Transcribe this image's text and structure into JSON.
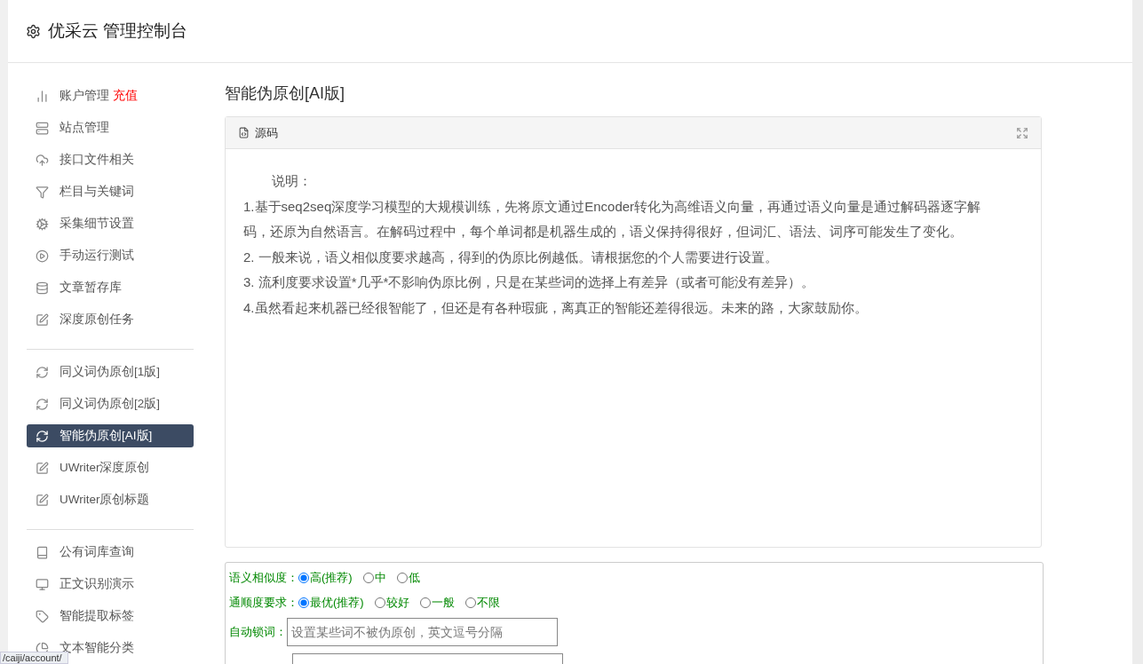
{
  "header": {
    "title": "优采云 管理控制台"
  },
  "sidebar": {
    "groups": [
      {
        "items": [
          {
            "label": "账户管理",
            "badge": "充值",
            "selected": false
          },
          {
            "label": "站点管理",
            "selected": false
          },
          {
            "label": "接口文件相关",
            "selected": false
          },
          {
            "label": "栏目与关键词",
            "selected": false
          },
          {
            "label": "采集细节设置",
            "selected": false
          },
          {
            "label": "手动运行测试",
            "selected": false
          },
          {
            "label": "文章暂存库",
            "selected": false
          },
          {
            "label": "深度原创任务",
            "selected": false
          }
        ]
      },
      {
        "items": [
          {
            "label": "同义词伪原创[1版]",
            "selected": false
          },
          {
            "label": "同义词伪原创[2版]",
            "selected": false
          },
          {
            "label": "智能伪原创[AI版]",
            "selected": true
          },
          {
            "label": "UWriter深度原创",
            "selected": false
          },
          {
            "label": "UWriter原创标题",
            "selected": false
          }
        ]
      },
      {
        "items": [
          {
            "label": "公有词库查询",
            "selected": false
          },
          {
            "label": "正文识别演示",
            "selected": false
          },
          {
            "label": "智能提取标签",
            "selected": false
          },
          {
            "label": "文本智能分类",
            "selected": false
          }
        ]
      }
    ]
  },
  "page_title": "智能伪原创[AI版]",
  "source_panel": {
    "label": "源码",
    "paragraphs": [
      "说明：",
      "1.基于seq2seq深度学习模型的大规模训练，先将原文通过Encoder转化为高维语义向量，再通过语义向量是通过解码器逐字解码，还原为自然语言。在解码过程中，每个单词都是机器生成的，语义保持得很好，但词汇、语法、词序可能发生了变化。",
      "2. 一般来说，语义相似度要求越高，得到的伪原比例越低。请根据您的个人需要进行设置。",
      "3. 流利度要求设置*几乎*不影响伪原比例，只是在某些词的选择上有差异（或者可能没有差异）。",
      "4.虽然看起来机器已经很智能了，但还是有各种瑕疵，离真正的智能还差得很远。未来的路，大家鼓励你。"
    ]
  },
  "options": [
    {
      "kind": "radio",
      "label": "语义相似度：",
      "choices": [
        {
          "label": "高(推荐)",
          "selected": true
        },
        {
          "label": "中",
          "selected": false
        },
        {
          "label": "低",
          "selected": false
        }
      ]
    },
    {
      "kind": "radio",
      "label": "通顺度要求：",
      "choices": [
        {
          "label": "最优(推荐)",
          "selected": true
        },
        {
          "label": "较好",
          "selected": false
        },
        {
          "label": "一般",
          "selected": false
        },
        {
          "label": "不限",
          "selected": false
        }
      ]
    },
    {
      "kind": "input",
      "label": "自动锁词：",
      "placeholder": "设置某些词不被伪原创，英文逗号分隔"
    },
    {
      "kind": "input"
    }
  ],
  "status_url": "/caiji/account/"
}
